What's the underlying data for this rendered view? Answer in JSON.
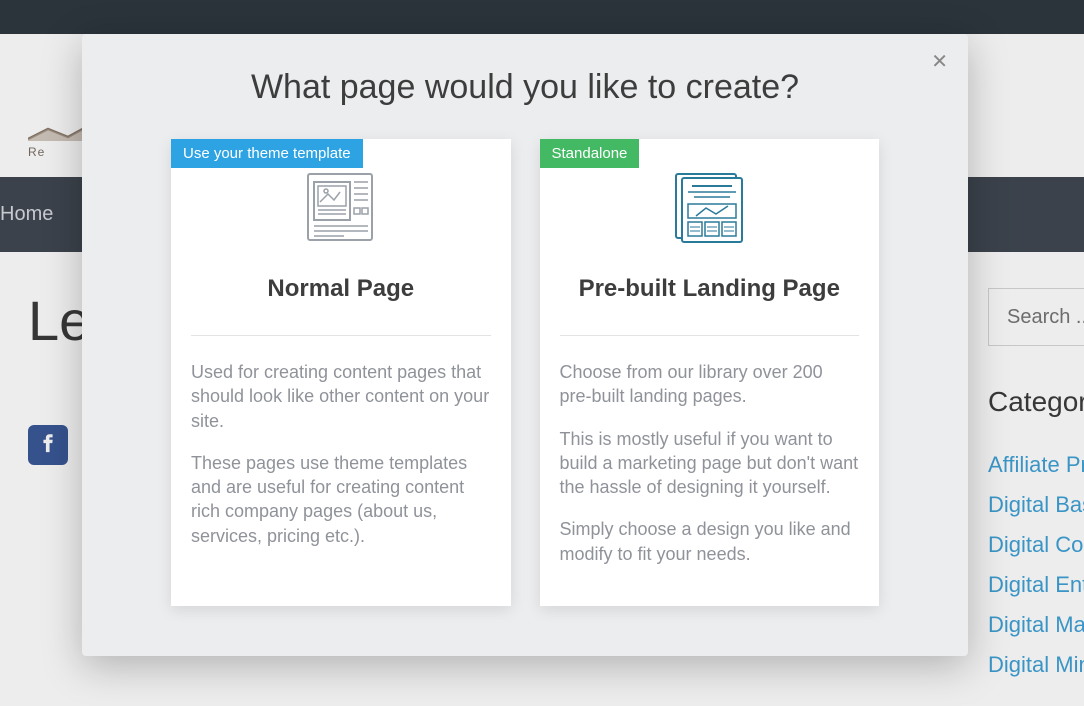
{
  "page": {
    "logo_text": "Re",
    "nav_home": "Home",
    "title_partial": "Let",
    "search_placeholder": "Search ...",
    "categories_heading": "Categories",
    "categories": [
      "Affiliate Pr",
      "Digital Basi",
      "Digital Con",
      "Digital Entr",
      "Digital Mar",
      "Digital Min"
    ]
  },
  "modal": {
    "title": "What page would you like to create?",
    "close": "✕",
    "cards": [
      {
        "badge": "Use your theme template",
        "title": "Normal Page",
        "paragraphs": [
          "Used for creating content pages that should look like other content on your site.",
          "These pages use theme templates and are useful for creating content rich company pages (about us, services, pricing etc.)."
        ]
      },
      {
        "badge": "Standalone",
        "title": "Pre-built Landing Page",
        "paragraphs": [
          "Choose from our library over 200 pre-built landing pages.",
          "This is mostly useful if you want to build a marketing page but don't want the hassle of designing it yourself.",
          "Simply choose a design you like and modify to fit your needs."
        ]
      }
    ]
  }
}
